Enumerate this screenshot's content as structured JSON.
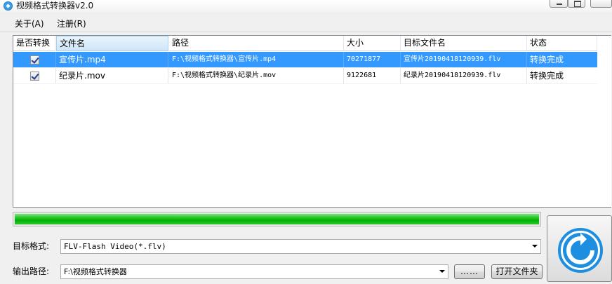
{
  "window": {
    "title": "视频格式转换器v2.0"
  },
  "menu": {
    "items": [
      {
        "label": "关于(A)"
      },
      {
        "label": "注册(R)"
      }
    ]
  },
  "file_list": {
    "columns": [
      "是否转换",
      "文件名",
      "路径",
      "大小",
      "目标文件名",
      "状态"
    ],
    "rows": [
      {
        "checked": true,
        "selected": true,
        "filename": "宣传片.mp4",
        "path": "F:\\视频格式转换器\\宣传片.mp4",
        "size": "70271877",
        "target": "宣传片20190418120939.flv",
        "status": "转换完成"
      },
      {
        "checked": true,
        "selected": false,
        "filename": "纪录片.mov",
        "path": "F:\\视频格式转换器\\纪录片.mov",
        "size": "9122681",
        "target": "纪录片20190418120939.flv",
        "status": "转换完成"
      }
    ]
  },
  "progress": {
    "percent": 100,
    "color": "#06b006"
  },
  "form": {
    "format_label": "目标格式:",
    "format_value": "FLV-Flash Video(*.flv)",
    "output_label": "输出路径:",
    "output_value": "F:\\视频格式转换器",
    "browse_label": "……",
    "open_folder_label": "打开文件夹"
  },
  "convert_button": {
    "icon": "refresh-icon",
    "color": "#1e8fe0"
  }
}
